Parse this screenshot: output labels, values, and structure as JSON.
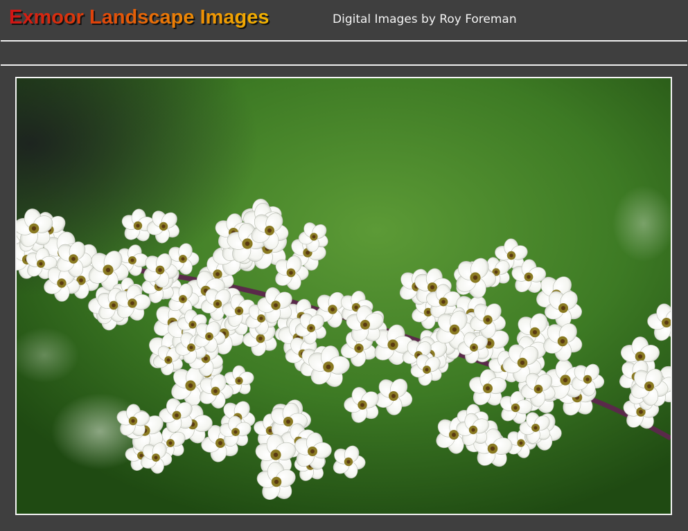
{
  "site": {
    "title": "Exmoor Landscape Images",
    "subtitle": "Digital Images by Roy Foreman"
  },
  "colors": {
    "page_background": "#3f3f3f",
    "rule": "#f0f0f0",
    "title_gradient_start": "#d01414",
    "title_gradient_end": "#f2b400",
    "subtitle_text": "#f4f4f4",
    "photo_background": "#2f6a1c",
    "blossom": "#fbfbf8",
    "blossom_center": "#8a7a22",
    "stem": "#5a2a4a"
  },
  "photo": {
    "subject": "white blossom spray on green background"
  }
}
